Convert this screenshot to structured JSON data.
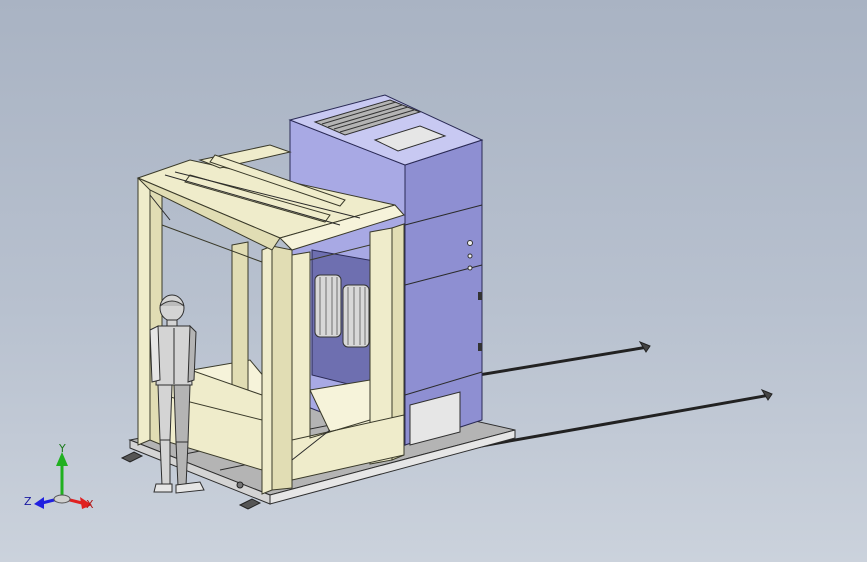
{
  "viewport": {
    "background_top": "#a9b3c3",
    "background_bottom": "#cbd2dc"
  },
  "model": {
    "booth_color": "#efeccb",
    "cabinet_color": "#a8a9e4",
    "figure_color": "#d4d4d4"
  },
  "triad": {
    "x_label": "X",
    "y_label": "Y",
    "z_label": "Z",
    "x_color": "#e02020",
    "y_color": "#20b020",
    "z_color": "#2020e0"
  }
}
